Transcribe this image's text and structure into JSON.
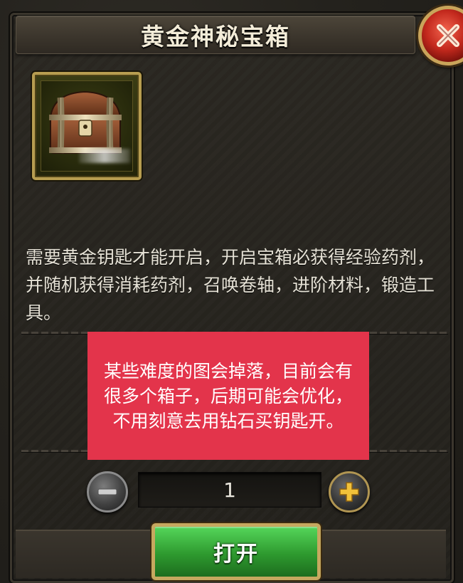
{
  "title": "黄金神秘宝箱",
  "item": {
    "icon": "treasure-chest-icon"
  },
  "description": "需要黄金钥匙才能开启，开启宝箱必获得经验药剂，并随机获得消耗药剂，召唤卷轴，进阶材料，锻造工具。",
  "overlay_note": "某些难度的图会掉落，目前会有很多个箱子，后期可能会优化，不用刻意去用钻石买钥匙开。",
  "quantity": {
    "value": "1"
  },
  "open_button": {
    "label": "打开"
  },
  "colors": {
    "overlay": "#e3344b",
    "open_button": "#2e9a2f",
    "close_button": "#c3291d",
    "gold_border": "#b79d50"
  }
}
